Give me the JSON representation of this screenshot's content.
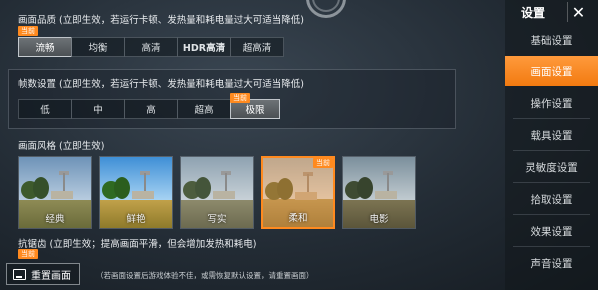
{
  "graphics_quality": {
    "title": "画面品质 (立即生效，若运行卡顿、发热量和耗电量过大可适当降低)",
    "tag": "当前",
    "options": [
      "流畅",
      "均衡",
      "高清",
      "HDR高清",
      "超高清"
    ],
    "selected": "流畅"
  },
  "frame_rate": {
    "title": "帧数设置 (立即生效，若运行卡顿、发热量和耗电量过大可适当降低)",
    "tag": "当前",
    "options": [
      "低",
      "中",
      "高",
      "超高",
      "极限"
    ],
    "selected": "极限"
  },
  "style": {
    "title": "画面风格 (立即生效)",
    "tag": "当前",
    "options": [
      "经典",
      "鲜艳",
      "写实",
      "柔和",
      "电影"
    ],
    "selected": "柔和"
  },
  "anti_aliasing": {
    "title": "抗锯齿 (立即生效；提高画面平滑，但会增加发热和耗电)",
    "tag": "当前"
  },
  "reset": {
    "label": "重置画面",
    "note": "（若画面设置后游戏体验不佳，或需恢复默认设置，请重置画面）"
  },
  "sidebar": {
    "title": "设置",
    "close": "✕",
    "items": [
      "基础设置",
      "画面设置",
      "操作设置",
      "载具设置",
      "灵敏度设置",
      "拾取设置",
      "效果设置",
      "声音设置"
    ],
    "active": "画面设置"
  },
  "colors": {
    "accent": "#ff8a1f"
  }
}
